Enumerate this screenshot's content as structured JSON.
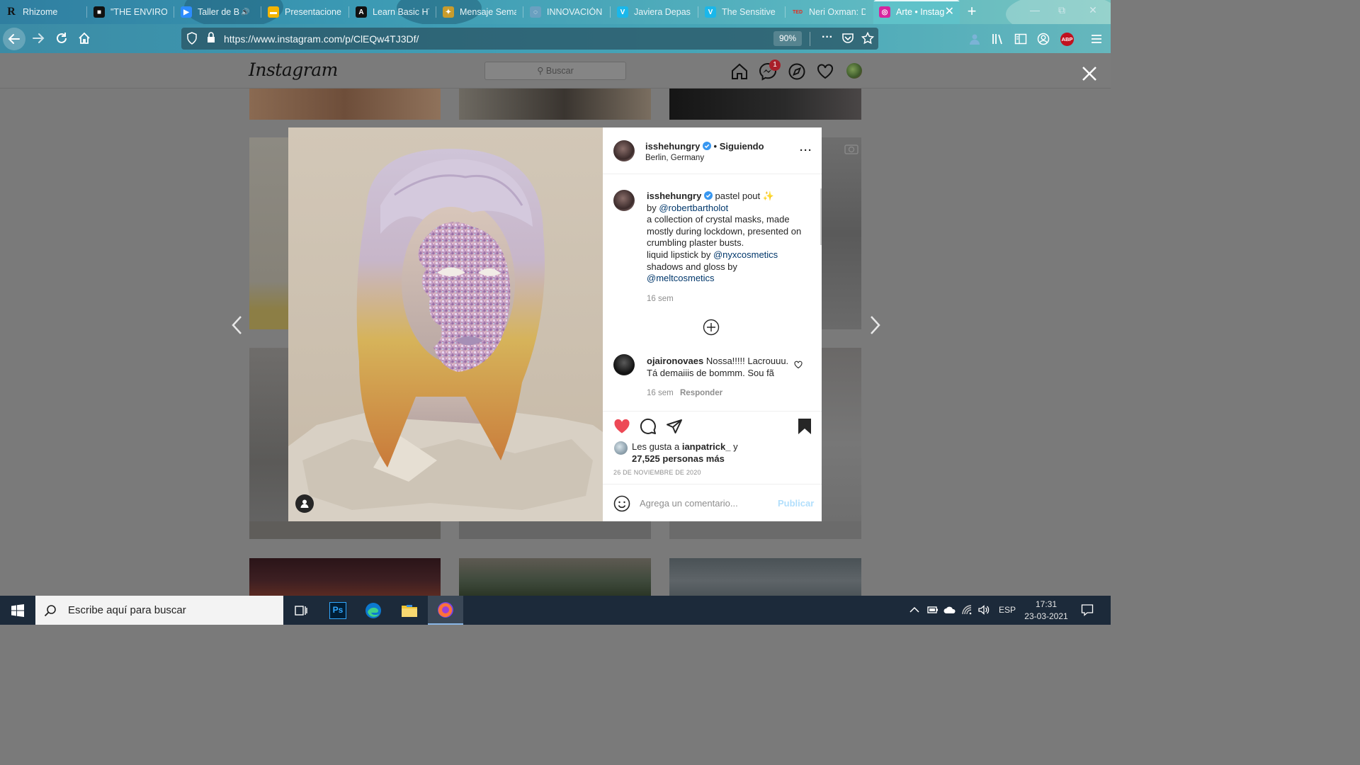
{
  "browser": {
    "tabs": [
      {
        "label": "Rhizome",
        "icon": "rhizome-r-icon",
        "icon_char": "R",
        "icon_color": "#111111",
        "active": false
      },
      {
        "label": "\"THE ENVIRON",
        "icon": "video-icon",
        "icon_char": "■",
        "icon_color": "#111111",
        "active": false
      },
      {
        "label": "Taller de B",
        "icon": "zoom-camera-icon",
        "icon_char": "▶",
        "icon_color": "#2d8cff",
        "active": false,
        "audio": true
      },
      {
        "label": "Presentaciones",
        "icon": "slides-icon",
        "icon_char": "▬",
        "icon_color": "#f4b400",
        "active": false
      },
      {
        "label": "Learn Basic HT",
        "icon": "code-icon",
        "icon_char": "A",
        "icon_color": "#111111",
        "active": false
      },
      {
        "label": "Mensaje Sema",
        "icon": "emblem-icon",
        "icon_char": "✦",
        "icon_color": "#c89c2c",
        "active": false
      },
      {
        "label": "INNOVACIÓN",
        "icon": "spinner-icon",
        "icon_char": "◌",
        "icon_color": "#6aa0c0",
        "active": false
      },
      {
        "label": "Javiera Depas",
        "icon": "vimeo-icon",
        "icon_char": "V",
        "icon_color": "#1ab7ea",
        "active": false
      },
      {
        "label": "The Sensitive I",
        "icon": "vimeo-icon",
        "icon_char": "V",
        "icon_color": "#1ab7ea",
        "active": false
      },
      {
        "label": "Neri Oxman: D",
        "icon": "ted-icon",
        "icon_char": "TED",
        "icon_color": "#e62b1e",
        "active": false
      },
      {
        "label": "Arte • Instag",
        "icon": "instagram-icon",
        "icon_char": "◎",
        "icon_color": "#d6249f",
        "active": true
      }
    ],
    "url": "https://www.instagram.com/p/ClEQw4TJ3Df/",
    "zoom": "90%",
    "abp_label": "ABP"
  },
  "instagram": {
    "logo": "Instagram",
    "search_placeholder": "Buscar",
    "messages_badge": "1",
    "post": {
      "username": "isshehungry",
      "verified": true,
      "follow_status": "• Siguiendo",
      "location": "Berlin, Germany",
      "caption": {
        "title": "pastel pout ✨",
        "by_prefix": "by",
        "mention_author": "@robertbartholot",
        "body": "a collection of crystal masks, made mostly during lockdown, presented on crumbling plaster busts.",
        "lipstick_prefix": "liquid lipstick by",
        "mention_lipstick": "@nyxcosmetics",
        "shadows_prefix": "shadows and gloss by",
        "mention_shadows": "@meltcosmetics",
        "time": "16 sem"
      },
      "comment": {
        "username": "ojaironovaes",
        "text_line1": "Nossa!!!!! Lacrouuu.",
        "text_line2": "Tá demaiiis de bommm. Sou fã",
        "time": "16 sem",
        "reply_label": "Responder"
      },
      "likes": {
        "prefix": "Les gusta a",
        "user": "ianpatrick_",
        "conj": "y",
        "count_text": "27,525 personas más"
      },
      "date": "26 DE NOVIEMBRE DE 2020",
      "comment_placeholder": "Agrega un comentario...",
      "publish_label": "Publicar",
      "liked": true,
      "saved": true
    }
  },
  "taskbar": {
    "search_placeholder": "Escribe aquí para buscar",
    "ps_label": "Ps",
    "language": "ESP",
    "time": "17:31",
    "date": "23-03-2021"
  },
  "colors": {
    "heart_red": "#ed4956",
    "link_blue": "#00376b",
    "verified_blue": "#3897f0",
    "publish_blue": "#b2dffc",
    "taskbar": "#1c2a3a"
  }
}
